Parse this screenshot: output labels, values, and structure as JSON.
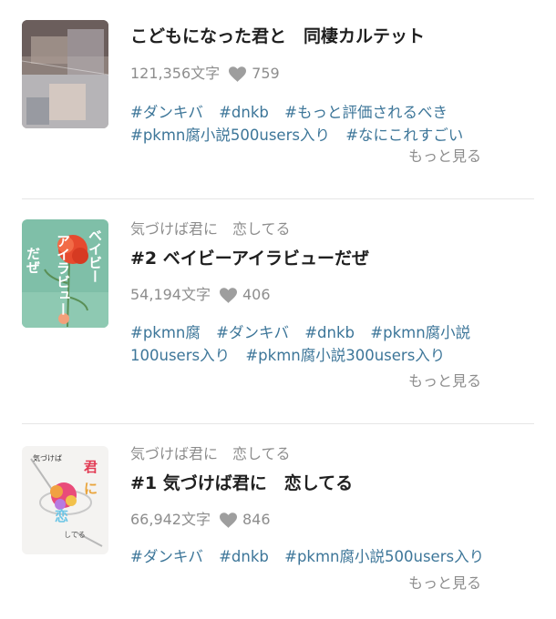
{
  "works": [
    {
      "series": "",
      "title": "こどもになった君と　同棲カルテット",
      "char_count": "121,356文字",
      "likes": "759",
      "tags": [
        "#ダンキバ",
        "#dnkb",
        "#もっと評価されるべき",
        "#pkmn腐小説500users入り",
        "#なにこれすごい"
      ],
      "more_label": "もっと見る",
      "thumb_text": [
        "",
        ""
      ]
    },
    {
      "series": "気づけば君に　恋してる",
      "title": "#2 ベイビーアイラビューだぜ",
      "char_count": "54,194文字",
      "likes": "406",
      "tags": [
        "#pkmn腐",
        "#ダンキバ",
        "#dnkb",
        "#pkmn腐小説",
        "100users入り",
        "#pkmn腐小説300users入り"
      ],
      "more_label": "もっと見る",
      "thumb_text": [
        "ベイビー",
        "アイラビュー",
        "だぜ"
      ]
    },
    {
      "series": "気づけば君に　恋してる",
      "title": "#1 気づけば君に　恋してる",
      "char_count": "66,942文字",
      "likes": "846",
      "tags": [
        "#ダンキバ",
        "#dnkb",
        "#pkmn腐小説500users入り"
      ],
      "more_label": "もっと見る",
      "thumb_text": [
        "気づけば",
        "君",
        "に",
        "恋",
        "してる"
      ]
    }
  ],
  "colors": {
    "tag": "#3d7699",
    "muted": "#8d8d8d",
    "title": "#1f1f1f",
    "divider": "#e6e6e6"
  }
}
